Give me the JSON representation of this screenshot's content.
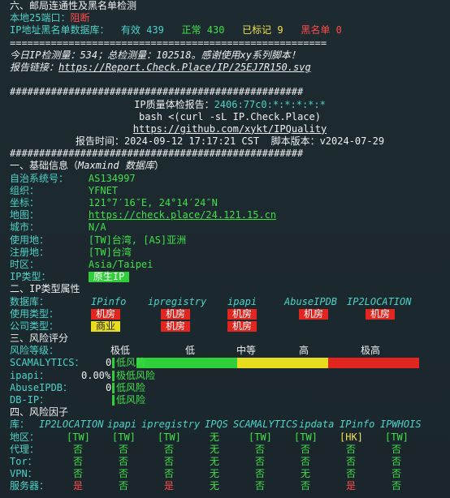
{
  "mail": {
    "title": "六、邮局连通性及黑名单检测",
    "port25_label": "本地25端口：",
    "port25_value": "阻断",
    "db_label": "IP地址黑名单数据库：",
    "valid_label": "有效",
    "valid_value": "439",
    "normal_label": "正常",
    "normal_value": "430",
    "marked_label": "已标记",
    "marked_value": "9",
    "black_label": "黑名单",
    "black_value": "0"
  },
  "separator_eq": "======================================================",
  "separator_hash": "##################################################",
  "stats_line": "今日IP检测量：534；总检测量：102518。感谢使用xy系列脚本！",
  "report_label": "报告链接：",
  "report_link": "https://Report.Check.Place/IP/25EJ7R150.svg",
  "header": {
    "report_title": "IP质量体检报告：",
    "ip_masked": "2406:77c0:*:*:*:*:*",
    "command": "bash <(curl -sL IP.Check.Place)",
    "github": "https://github.com/xykt/IPQuality",
    "report_time_label": "报告时间：",
    "report_time": "2024-09-12 17:17:21 CST",
    "version_label": "脚本版本：",
    "version": "v2024-07-29"
  },
  "basic": {
    "title": "一、基础信息（",
    "source": "Maxmind 数据库",
    "title_end": "）",
    "rows": [
      {
        "label": "自治系统号：",
        "value": "AS134997"
      },
      {
        "label": "组织：",
        "value": "YFNET"
      },
      {
        "label": "坐标：",
        "value": "121°7′16″E, 24°14′24″N"
      },
      {
        "label": "地图：",
        "value": "https://check.place/24.121.15.cn"
      },
      {
        "label": "城市：",
        "value": "N/A"
      },
      {
        "label": "使用地：",
        "value": "[TW]台湾, [AS]亚洲"
      },
      {
        "label": "注册地：",
        "value": "[TW]台湾"
      },
      {
        "label": "时区：",
        "value": "Asia/Taipei"
      },
      {
        "label": "IP类型：",
        "value": "原生IP"
      }
    ]
  },
  "iptype": {
    "title": "二、IP类型属性",
    "db_label": "数据库：",
    "dbs": [
      "IPinfo",
      "ipregistry",
      "ipapi",
      "AbuseIPDB",
      "IP2LOCATION"
    ],
    "usage_label": "使用类型：",
    "usage": [
      "机房",
      "机房",
      "机房",
      "机房",
      "机房"
    ],
    "company_label": "公司类型：",
    "company": [
      "商业",
      "机房",
      "机房"
    ]
  },
  "risk": {
    "title": "三、风险评分",
    "level_label": "风险等级：",
    "levels": [
      "极低",
      "低",
      "中等",
      "高",
      "极高"
    ],
    "rows": [
      {
        "label": "SCAMALYTICS：",
        "score": "0",
        "desc": "低风险"
      },
      {
        "label": "ipapi：",
        "score": "0.00%",
        "desc": "极低风险"
      },
      {
        "label": "AbuseIPDB：",
        "score": "0",
        "desc": "低风险"
      },
      {
        "label": "DB-IP：",
        "score": "",
        "desc": "低风险"
      }
    ]
  },
  "factors": {
    "title": "四、风险因子",
    "lib_label": "库：",
    "libs": [
      "IP2LOCATION",
      "ipapi",
      "ipregistry",
      "IPQS",
      "SCAMALYTICS",
      "ipdata",
      "IPinfo",
      "IPWHOIS"
    ],
    "rows": [
      {
        "label": "地区：",
        "values": [
          "[TW]",
          "[TW]",
          "[TW]",
          "无",
          "[TW]",
          "[TW]",
          "[HK]",
          "[TW]"
        ]
      },
      {
        "label": "代理：",
        "values": [
          "否",
          "否",
          "否",
          "无",
          "否",
          "否",
          "否",
          "否"
        ]
      },
      {
        "label": "Tor：",
        "values": [
          "否",
          "否",
          "否",
          "无",
          "否",
          "否",
          "否",
          "否"
        ]
      },
      {
        "label": "VPN：",
        "values": [
          "否",
          "否",
          "否",
          "无",
          "否",
          "无",
          "否",
          "否"
        ]
      },
      {
        "label": "服务器：",
        "values": [
          "是",
          "否",
          "是",
          "无",
          "否",
          "否",
          "是",
          "否"
        ]
      }
    ]
  },
  "colors": {
    "bg": "#1c2a30",
    "cyan": "#4ad3c8",
    "green": "#3ee04a",
    "yellow": "#f2e04a",
    "red": "#ff4a4a"
  }
}
